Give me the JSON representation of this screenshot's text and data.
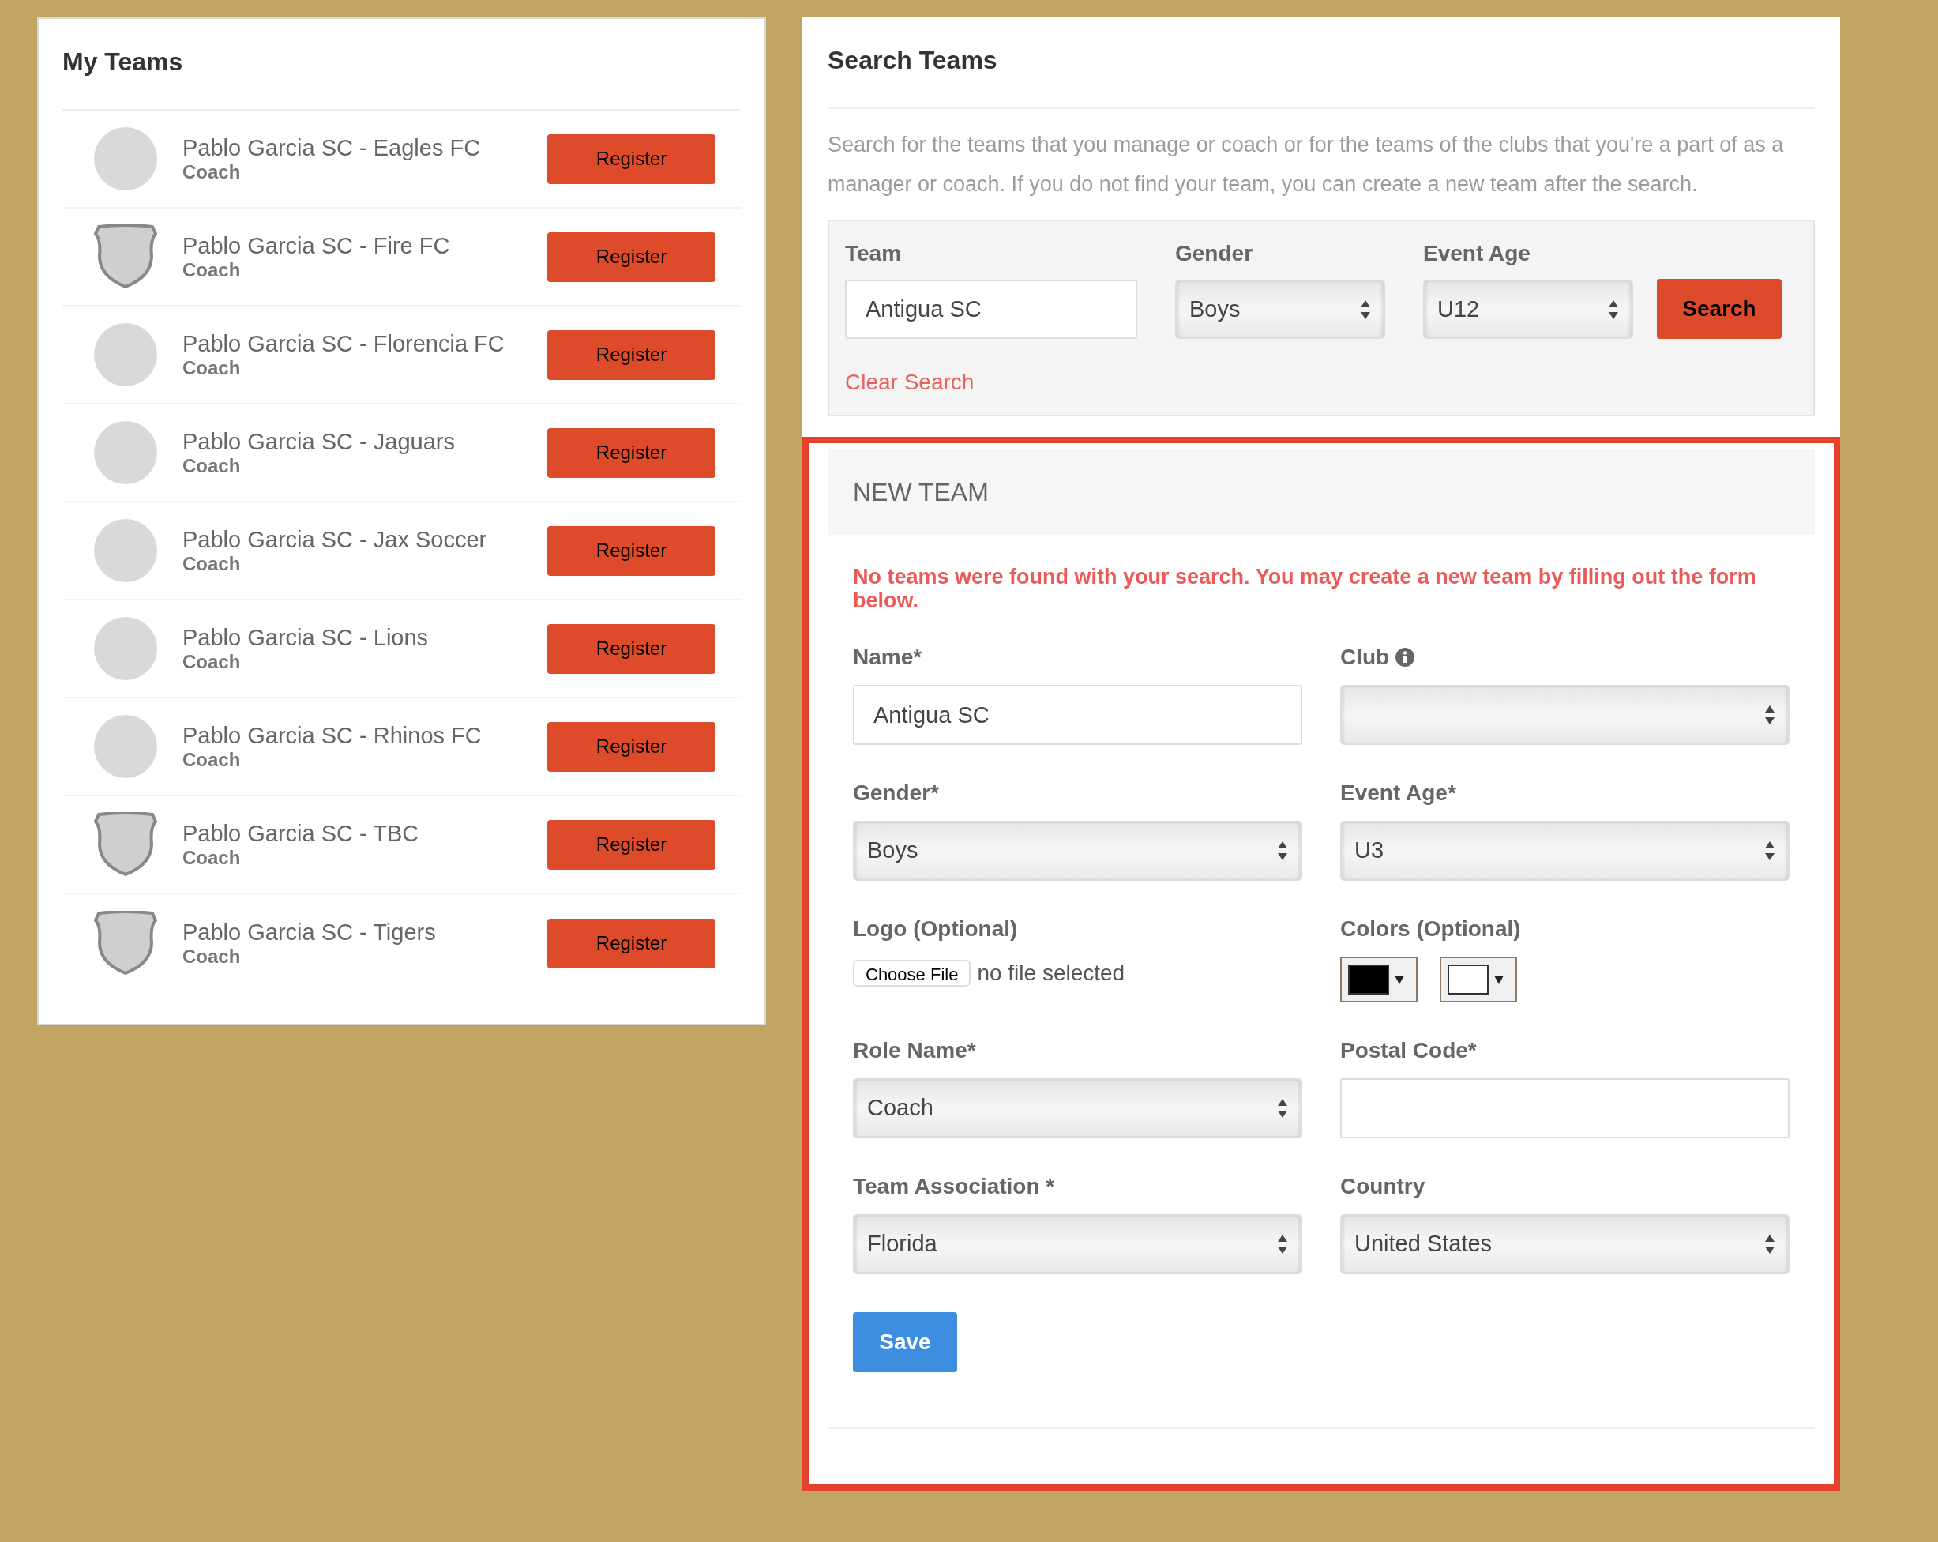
{
  "my_teams": {
    "title": "My Teams",
    "teams": [
      {
        "name": "Pablo Garcia SC - Eagles FC",
        "role": "Coach",
        "kind": "logo",
        "button": "Register"
      },
      {
        "name": "Pablo Garcia SC - Fire FC",
        "role": "Coach",
        "kind": "shield",
        "button": "Register"
      },
      {
        "name": "Pablo Garcia SC - Florencia FC",
        "role": "Coach",
        "kind": "logo",
        "button": "Register"
      },
      {
        "name": "Pablo Garcia SC - Jaguars",
        "role": "Coach",
        "kind": "logo",
        "button": "Register"
      },
      {
        "name": "Pablo Garcia SC - Jax Soccer",
        "role": "Coach",
        "kind": "logo",
        "button": "Register"
      },
      {
        "name": "Pablo Garcia SC - Lions",
        "role": "Coach",
        "kind": "logo",
        "button": "Register"
      },
      {
        "name": "Pablo Garcia SC - Rhinos FC",
        "role": "Coach",
        "kind": "logo",
        "button": "Register"
      },
      {
        "name": "Pablo Garcia SC - TBC",
        "role": "Coach",
        "kind": "shield",
        "button": "Register"
      },
      {
        "name": "Pablo Garcia SC - Tigers",
        "role": "Coach",
        "kind": "shield",
        "button": "Register"
      }
    ]
  },
  "search_teams": {
    "title": "Search Teams",
    "description": "Search for the teams that you manage or coach or for the teams of the clubs that you're a part of as a manager or coach. If you do not find your team, you can create a new team after the search.",
    "fields": [
      {
        "label": "Team",
        "kind": "text",
        "value": "Antigua SC"
      },
      {
        "label": "Gender",
        "kind": "select",
        "value": "Boys"
      },
      {
        "label": "Event Age",
        "kind": "select",
        "value": "U12"
      }
    ],
    "search_button": "Search",
    "clear_link": "Clear Search"
  },
  "new_team": {
    "title": "NEW TEAM",
    "message": "No teams were found with your search. You may create a new team by filling out the form below.",
    "fields": [
      {
        "label": "Name*",
        "kind": "text",
        "value": "Antigua SC"
      },
      {
        "label": "Club",
        "kind": "select",
        "info": true
      },
      {
        "label": "Gender*",
        "kind": "select",
        "value": "Boys"
      },
      {
        "label": "Event Age*",
        "kind": "select",
        "value": "U3"
      },
      {
        "label": "Logo (Optional)",
        "kind": "file",
        "button": "Choose File",
        "status": "no file selected"
      },
      {
        "label": "Colors (Optional)",
        "kind": "colors",
        "swatches": [
          {
            "color": "#000000"
          },
          {
            "color": "#ffffff"
          }
        ]
      },
      {
        "label": "Role Name*",
        "kind": "select",
        "value": "Coach"
      },
      {
        "label": "Postal Code*",
        "kind": "text"
      },
      {
        "label": "Team Association *",
        "kind": "select",
        "value": "Florida"
      },
      {
        "label": "Country",
        "kind": "select",
        "value": "United States"
      }
    ],
    "save_button": "Save"
  }
}
